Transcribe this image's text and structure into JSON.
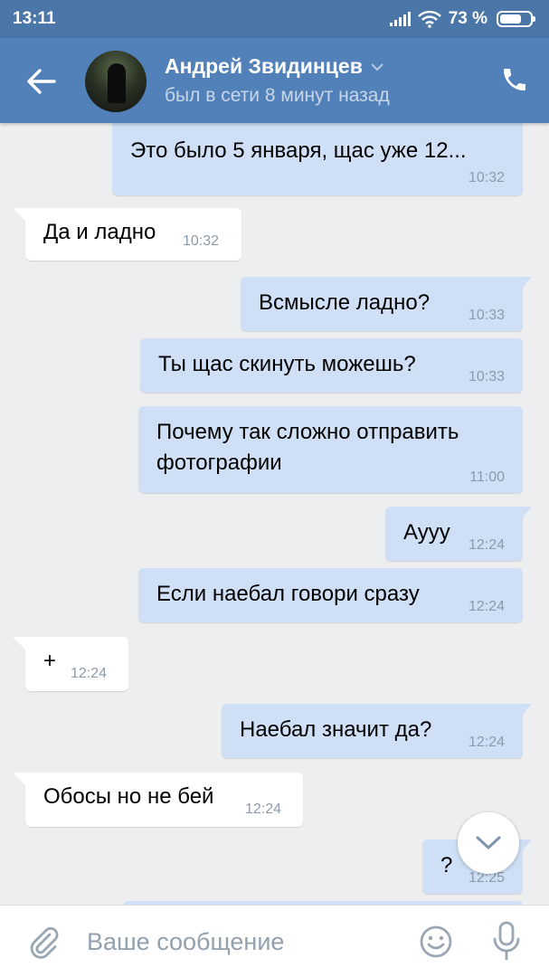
{
  "status_bar": {
    "time": "13:11",
    "battery": "73 %",
    "battery_level": 0.73
  },
  "header": {
    "contact_name": "Андрей Звидинцев",
    "contact_status": "был в сети 8 минут назад"
  },
  "messages": [
    {
      "dir": "out",
      "text": "Это было 5 января, щас уже 12...",
      "time": "10:32"
    },
    {
      "dir": "in",
      "text": "Да и ладно",
      "time": "10:32"
    },
    {
      "dir": "out",
      "text": "Всмысле ладно?",
      "time": "10:33"
    },
    {
      "dir": "out",
      "text": "Ты щас скинуть можешь?",
      "time": "10:33"
    },
    {
      "dir": "out",
      "line1": "Почему так сложно отправить",
      "line2": "фотографии",
      "time": "11:00"
    },
    {
      "dir": "out",
      "text": "Аууу",
      "time": "12:24"
    },
    {
      "dir": "out",
      "text": "Если наебал говори сразу",
      "time": "12:24"
    },
    {
      "dir": "in",
      "text": "+",
      "time": "12:24"
    },
    {
      "dir": "out",
      "text": "Наебал значит да?",
      "time": "12:24"
    },
    {
      "dir": "in",
      "text": "Обосы но не бей",
      "time": "12:24"
    },
    {
      "dir": "out",
      "text": "?",
      "time": "12:25"
    }
  ],
  "composer": {
    "placeholder": "Ваше сообщение"
  },
  "colors": {
    "header": "#5181b8",
    "status_bar": "#4a76a8",
    "outgoing_bubble": "#cfe0f6",
    "incoming_bubble": "#ffffff",
    "background": "#edeef0"
  },
  "icons": [
    "back-arrow-icon",
    "chevron-down-icon",
    "phone-icon",
    "attach-icon",
    "emoji-icon",
    "microphone-icon",
    "wifi-icon",
    "signal-icon",
    "battery-icon"
  ]
}
